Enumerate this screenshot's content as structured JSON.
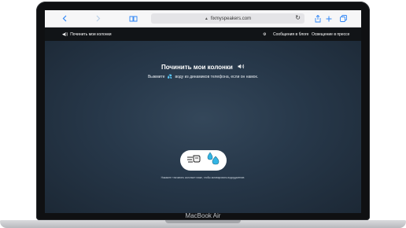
{
  "device": {
    "brand_label": "MacBook Air"
  },
  "browser": {
    "url": "fixmyspeakers.com",
    "icons": [
      "back-icon",
      "forward-icon",
      "book-icon",
      "lock-icon",
      "reload-icon",
      "share-icon",
      "plus-icon",
      "tabs-icon"
    ]
  },
  "site_nav": {
    "logo_text": "Починить мои колонки",
    "items": [
      "Сообщения в блоге",
      "Освещение в прессе"
    ]
  },
  "hero": {
    "title": "Починить мои колонки",
    "subtitle_before": "Выжмите",
    "subtitle_after": "воду из динамиков телефона, если он намок.",
    "hint": "Нажмите «починить колонки» ниже, чтобы активировать водоудаление."
  },
  "colors": {
    "accent": "#33b5e5",
    "page_bg": "#1f2b38"
  }
}
